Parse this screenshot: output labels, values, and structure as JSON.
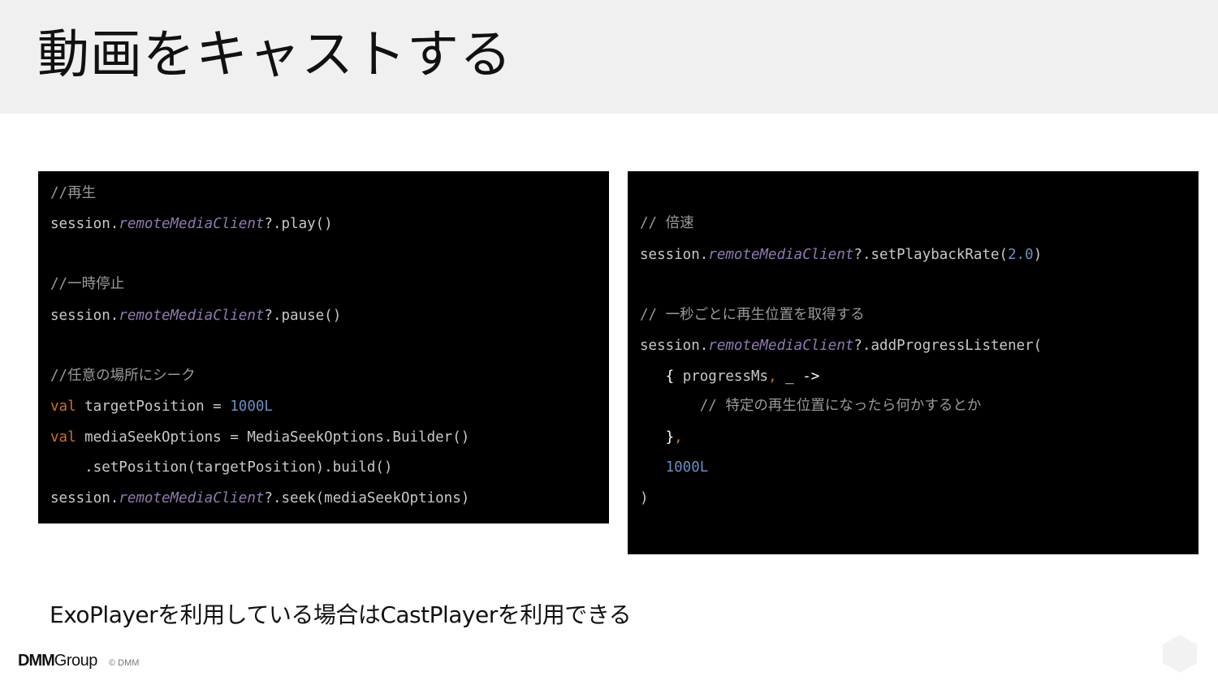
{
  "slide": {
    "title": "動画をキャストする",
    "caption": "ExoPlayerを利用している場合はCastPlayerを利用できる"
  },
  "left_code": {
    "c_play": "//再生",
    "session": "session.",
    "client": "remoteMediaClient",
    "play": "?.play()",
    "c_pause": "//一時停止",
    "pause": "?.pause()",
    "c_seek": "//任意の場所にシーク",
    "val": "val",
    "target_decl": " targetPosition = ",
    "num_1000": "1000L",
    "options_decl": " mediaSeekOptions = MediaSeekOptions.Builder()",
    "set_position": "    .setPosition(targetPosition).build()",
    "seek": "?.seek(mediaSeekOptions)"
  },
  "right_code": {
    "c_speed": "// 倍速",
    "session": "session.",
    "client": "remoteMediaClient",
    "set_rate": "?.setPlaybackRate(",
    "rate": "2.0",
    "close": ")",
    "c_progress": "// 一秒ごとに再生位置を取得する",
    "add_listener": "?.addProgressListener(",
    "brace_open": "   {",
    "lambda_params": " progressMs",
    "comma": ",",
    "underscore_arrow": " _ ->",
    "c_inner": "       // 特定の再生位置になったら何かするとか",
    "brace_close": "   }",
    "interval": "   1000L",
    "paren_close": ")"
  },
  "footer": {
    "logo_dmm": "DMM",
    "logo_group": "Group",
    "copyright": "© DMM"
  },
  "colors": {
    "comment": "#9a9a9a",
    "italic_member": "#8f7bb0",
    "keyword": "#cc6f2a",
    "number": "#6b8fbf",
    "default_code": "#c9c9c9",
    "panel_bg": "#000000",
    "title_bar_bg": "#f0f0f0"
  }
}
